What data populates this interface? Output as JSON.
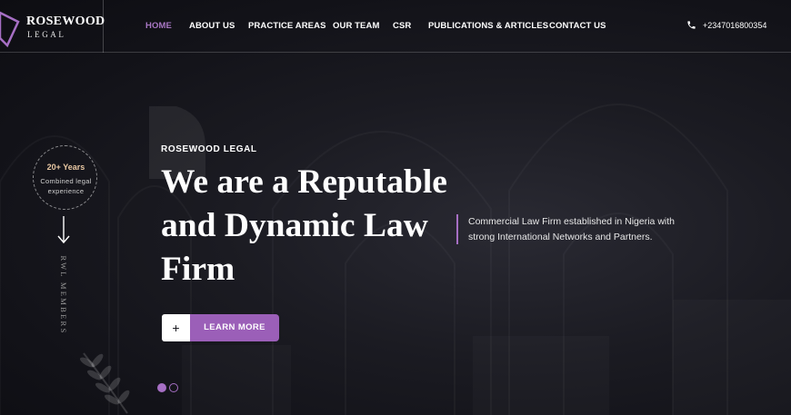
{
  "brand": {
    "name": "ROSEWOOD",
    "subtitle": "LEGAL",
    "accent_color": "#a66fc4"
  },
  "nav": {
    "items": [
      {
        "label": "HOME",
        "active": true
      },
      {
        "label": "ABOUT US",
        "active": false
      },
      {
        "label": "PRACTICE AREAS",
        "active": false
      },
      {
        "label": "OUR TEAM",
        "active": false
      },
      {
        "label": "CSR",
        "active": false
      },
      {
        "label": "PUBLICATIONS & ARTICLES",
        "active": false
      },
      {
        "label": "CONTACT US",
        "active": false
      }
    ]
  },
  "contact": {
    "icon": "phone-icon",
    "phone": "+2347016800354"
  },
  "badge": {
    "years": "20+ Years",
    "line1": "Combined legal",
    "line2": "experience"
  },
  "vertical_label": "RWL MEMBERS",
  "hero": {
    "eyebrow": "ROSEWOOD LEGAL",
    "headline_line1": "We are a Reputable",
    "headline_line2": "and Dynamic Law",
    "headline_line3": "Firm",
    "side_line1": "Commercial Law Firm established in Nigeria with",
    "side_line2": "strong International Networks and Partners."
  },
  "cta": {
    "plus": "+",
    "label": "LEARN MORE",
    "button_color": "#9b5fb8"
  },
  "slider": {
    "slide_count": 2,
    "active_slide": 1
  }
}
